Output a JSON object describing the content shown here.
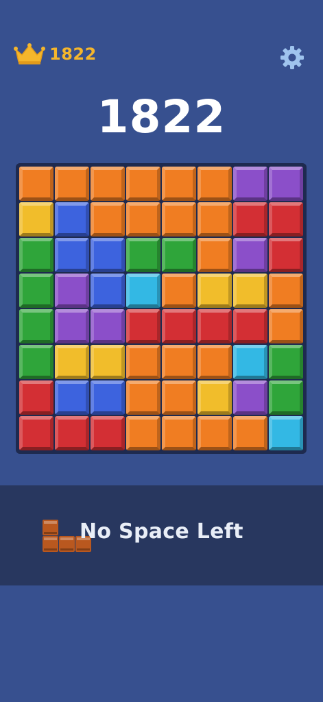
{
  "header": {
    "best_score": "1822",
    "crown_icon": "crown-icon",
    "settings_icon": "gear-icon"
  },
  "score": {
    "current": "1822"
  },
  "palette": {
    "O": "#f07d22",
    "P": "#8b4fc9",
    "Y": "#f1bd2b",
    "B": "#3d63de",
    "R": "#d32f34",
    "G": "#2fa53a",
    "C": "#33b8e4"
  },
  "board": [
    [
      "O",
      "O",
      "O",
      "O",
      "O",
      "O",
      "P",
      "P"
    ],
    [
      "Y",
      "B",
      "O",
      "O",
      "O",
      "O",
      "R",
      "R"
    ],
    [
      "G",
      "B",
      "B",
      "G",
      "G",
      "O",
      "P",
      "R"
    ],
    [
      "G",
      "P",
      "B",
      "C",
      "O",
      "Y",
      "Y",
      "O"
    ],
    [
      "G",
      "P",
      "P",
      "R",
      "R",
      "R",
      "R",
      "O"
    ],
    [
      "G",
      "Y",
      "Y",
      "O",
      "O",
      "O",
      "C",
      "G"
    ],
    [
      "R",
      "B",
      "B",
      "O",
      "O",
      "Y",
      "P",
      "G"
    ],
    [
      "R",
      "R",
      "R",
      "O",
      "O",
      "O",
      "O",
      "C"
    ]
  ],
  "status": {
    "message": "No Space Left",
    "piece_color": "#b9581f"
  }
}
